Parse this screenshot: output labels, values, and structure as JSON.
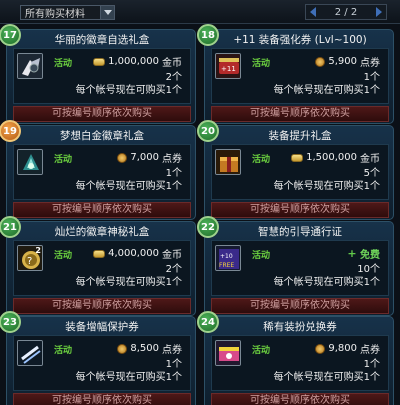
{
  "toolbar": {
    "category": "所有购买材料",
    "page": "2 / 2"
  },
  "buy_label": "可按编号顺序依次购买",
  "active_label": "活动",
  "items": [
    {
      "num": "17",
      "title": "华丽的徽章自选礼盒",
      "price": "1,000,000",
      "currency": "金币",
      "currency_icon": "gold-coin-icon",
      "qty": "2个",
      "limit": "每个帐号现在可购买1个",
      "icon": "winged-badge-icon"
    },
    {
      "num": "18",
      "title": "+11 装备强化券 (Lvl~100)",
      "price": "5,900",
      "currency": "点券",
      "currency_icon": "point-coin-icon",
      "qty": "1个",
      "limit": "每个帐号现在可购买1个",
      "icon": "enhance-ticket-icon"
    },
    {
      "num": "19",
      "title": "梦想白金徽章礼盒",
      "price": "7,000",
      "currency": "点券",
      "currency_icon": "point-coin-icon",
      "qty": "1个",
      "limit": "每个帐号现在可购买1个",
      "icon": "platinum-badge-icon"
    },
    {
      "num": "20",
      "title": "装备提升礼盒",
      "price": "1,500,000",
      "currency": "金币",
      "currency_icon": "gold-coin-icon",
      "qty": "5个",
      "limit": "每个帐号现在可购买1个",
      "icon": "upgrade-box-icon"
    },
    {
      "num": "21",
      "title": "灿烂的徽章神秘礼盒",
      "price": "4,000,000",
      "currency": "金币",
      "currency_icon": "gold-coin-icon",
      "qty": "2个",
      "limit": "每个帐号现在可购买1个",
      "icon": "mystery-badge-icon",
      "count": "2"
    },
    {
      "num": "22",
      "title": "智慧的引导通行证",
      "price": "免费",
      "currency": "",
      "currency_icon": "free-plus-icon",
      "qty": "10个",
      "limit": "每个帐号现在可购买1个",
      "icon": "free-pass-icon"
    },
    {
      "num": "23",
      "title": "装备增幅保护券",
      "price": "8,500",
      "currency": "点券",
      "currency_icon": "point-coin-icon",
      "qty": "1个",
      "limit": "每个帐号现在可购买1个",
      "icon": "protection-ticket-icon"
    },
    {
      "num": "24",
      "title": "稀有装扮兑换券",
      "price": "9,800",
      "currency": "点券",
      "currency_icon": "point-coin-icon",
      "qty": "1个",
      "limit": "每个帐号现在可购买1个",
      "icon": "avatar-voucher-icon"
    }
  ]
}
